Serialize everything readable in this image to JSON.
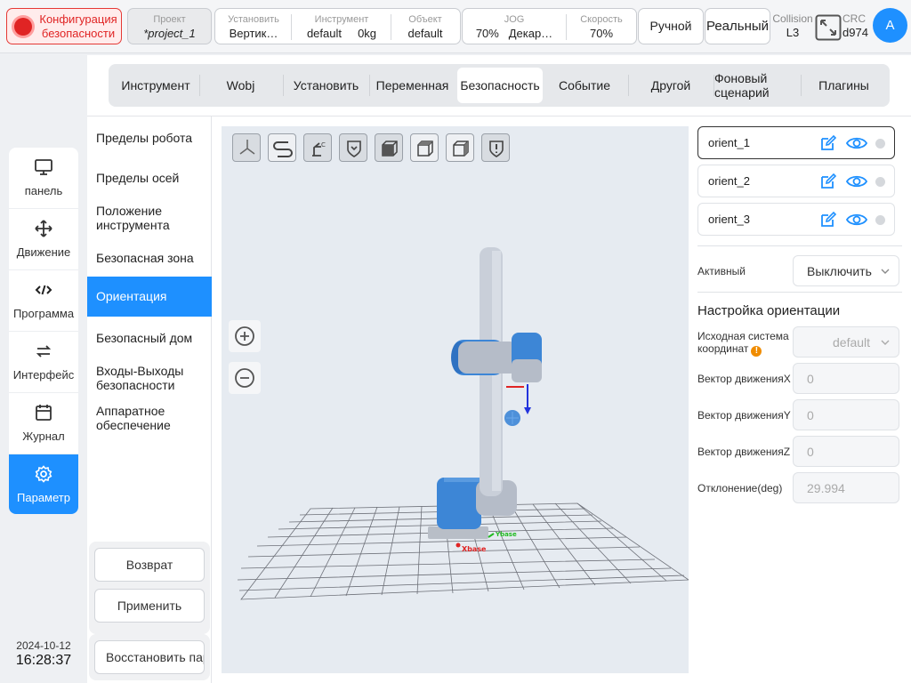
{
  "topbar": {
    "safety_config": "Конфигурация безопасности",
    "project": {
      "label": "Проект",
      "value": "*project_1"
    },
    "install": {
      "label": "Установить",
      "value": "Вертик…"
    },
    "tool": {
      "label": "Инструмент",
      "value": "default",
      "extra": "0kg"
    },
    "object": {
      "label": "Объект",
      "value": "default"
    },
    "jog": {
      "label": "JOG",
      "value": "70%",
      "extra": "Декар…"
    },
    "speed": {
      "label": "Скорость",
      "value": "70%"
    },
    "manual": "Ручной",
    "real": "Реальный",
    "collision": {
      "label": "Collision",
      "value": "L3"
    },
    "crc": {
      "label": "CRC",
      "value": "d974"
    },
    "avatar": "A"
  },
  "leftnav": [
    {
      "label": "панель",
      "icon": "monitor-icon"
    },
    {
      "label": "Движение",
      "icon": "move-icon"
    },
    {
      "label": "Программа",
      "icon": "code-icon"
    },
    {
      "label": "Интерфейс",
      "icon": "swap-icon"
    },
    {
      "label": "Журнал",
      "icon": "calendar-icon"
    },
    {
      "label": "Параметр",
      "icon": "gear-icon"
    }
  ],
  "datetime": {
    "date": "2024-10-12",
    "time": "16:28:37"
  },
  "tabs": [
    "Инструмент",
    "Wobj",
    "Установить",
    "Переменная",
    "Безопасность",
    "Событие",
    "Другой",
    "Фоновый сценарий",
    "Плагины"
  ],
  "submenu": [
    "Пределы робота",
    "Пределы осей",
    "Положение инструмента",
    "Безопасная зона",
    "Ориентация",
    "Безопасный дом",
    "Входы-Выходы безопасности",
    "Аппаратное обеспечение"
  ],
  "buttons": {
    "back": "Возврат",
    "apply": "Применить",
    "restore": "Восстановить парам"
  },
  "view": {
    "x_base": "Xbase",
    "y_base": "Ybase"
  },
  "orients": [
    "orient_1",
    "orient_2",
    "orient_3"
  ],
  "form": {
    "active_label": "Активный",
    "active_value": "Выключить",
    "section": "Настройка ориентации",
    "coord_label": "Исходная система координат",
    "coord_value": "default",
    "vx_label": "Вектор движенияX",
    "vx": "0",
    "vy_label": "Вектор движенияY",
    "vy": "0",
    "vz_label": "Вектор движенияZ",
    "vz": "0",
    "dev_label": "Отклонение(deg)",
    "dev": "29.994"
  },
  "colors": {
    "accent": "#1e90ff",
    "danger": "#e02424",
    "robot_blue": "#3d86d6"
  }
}
